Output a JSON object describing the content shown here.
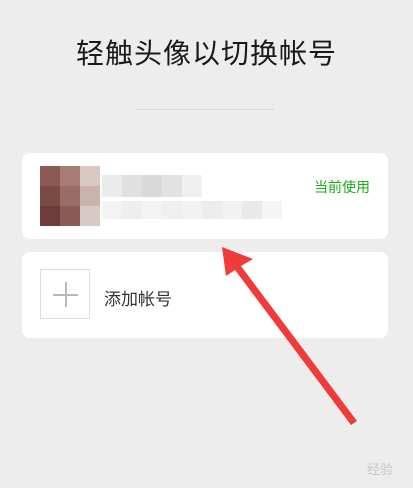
{
  "page": {
    "title": "轻触头像以切换帐号"
  },
  "accounts": {
    "current": {
      "status_label": "当前使用"
    },
    "add": {
      "label": "添加帐号"
    }
  },
  "colors": {
    "accent_green": "#1aad19",
    "arrow_red": "#f03b3b",
    "background": "#ededed"
  },
  "watermark": "经验"
}
